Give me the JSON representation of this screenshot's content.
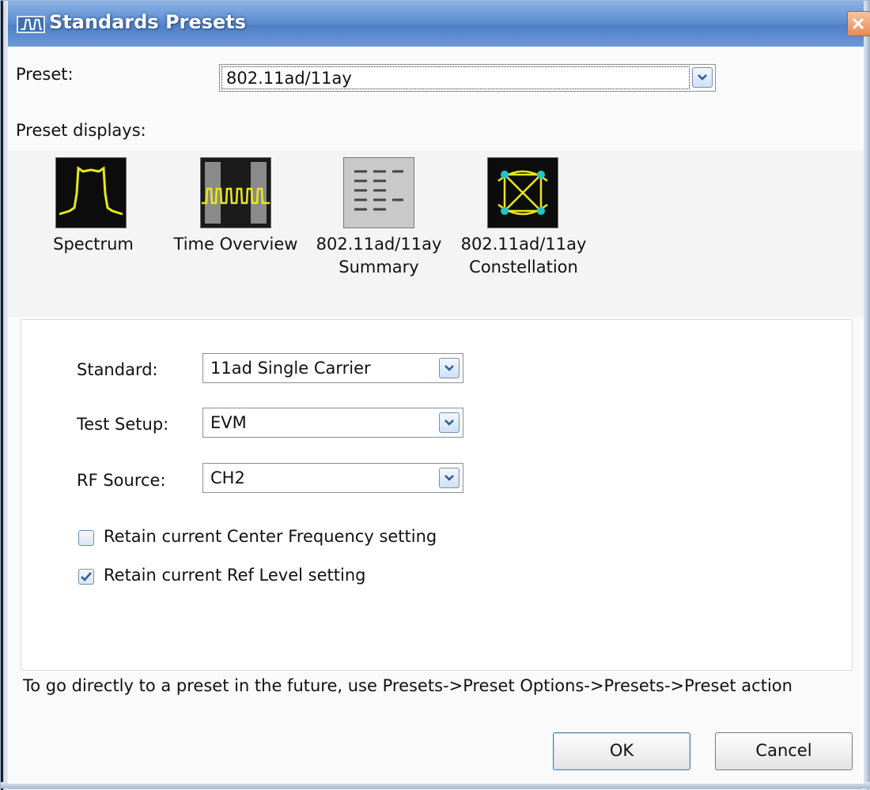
{
  "window": {
    "title": "Standards Presets"
  },
  "preset": {
    "label": "Preset:",
    "value": "802.11ad/11ay"
  },
  "displays": {
    "label": "Preset displays:",
    "items": [
      {
        "line1": "Spectrum",
        "line2": "",
        "icon": "spectrum-icon"
      },
      {
        "line1": "Time Overview",
        "line2": "",
        "icon": "time-overview-icon"
      },
      {
        "line1": "802.11ad/11ay",
        "line2": "Summary",
        "icon": "summary-icon"
      },
      {
        "line1": "802.11ad/11ay",
        "line2": "Constellation",
        "icon": "constellation-icon"
      }
    ]
  },
  "settings": {
    "standard": {
      "label": "Standard:",
      "value": "11ad Single Carrier"
    },
    "test_setup": {
      "label": "Test Setup:",
      "value": "EVM"
    },
    "rf_source": {
      "label": "RF Source:",
      "value": "CH2"
    },
    "retain_center": {
      "label": "Retain current Center Frequency setting",
      "checked": false
    },
    "retain_ref": {
      "label": "Retain current Ref Level setting",
      "checked": true
    }
  },
  "note": "To go directly to a preset in the future, use Presets->Preset Options->Presets->Preset action",
  "buttons": {
    "ok": "OK",
    "cancel": "Cancel"
  },
  "colors": {
    "title_bar": "#5f8fd2",
    "trace_yellow": "#e8e81a",
    "constellation_cyan": "#22c6c6"
  }
}
